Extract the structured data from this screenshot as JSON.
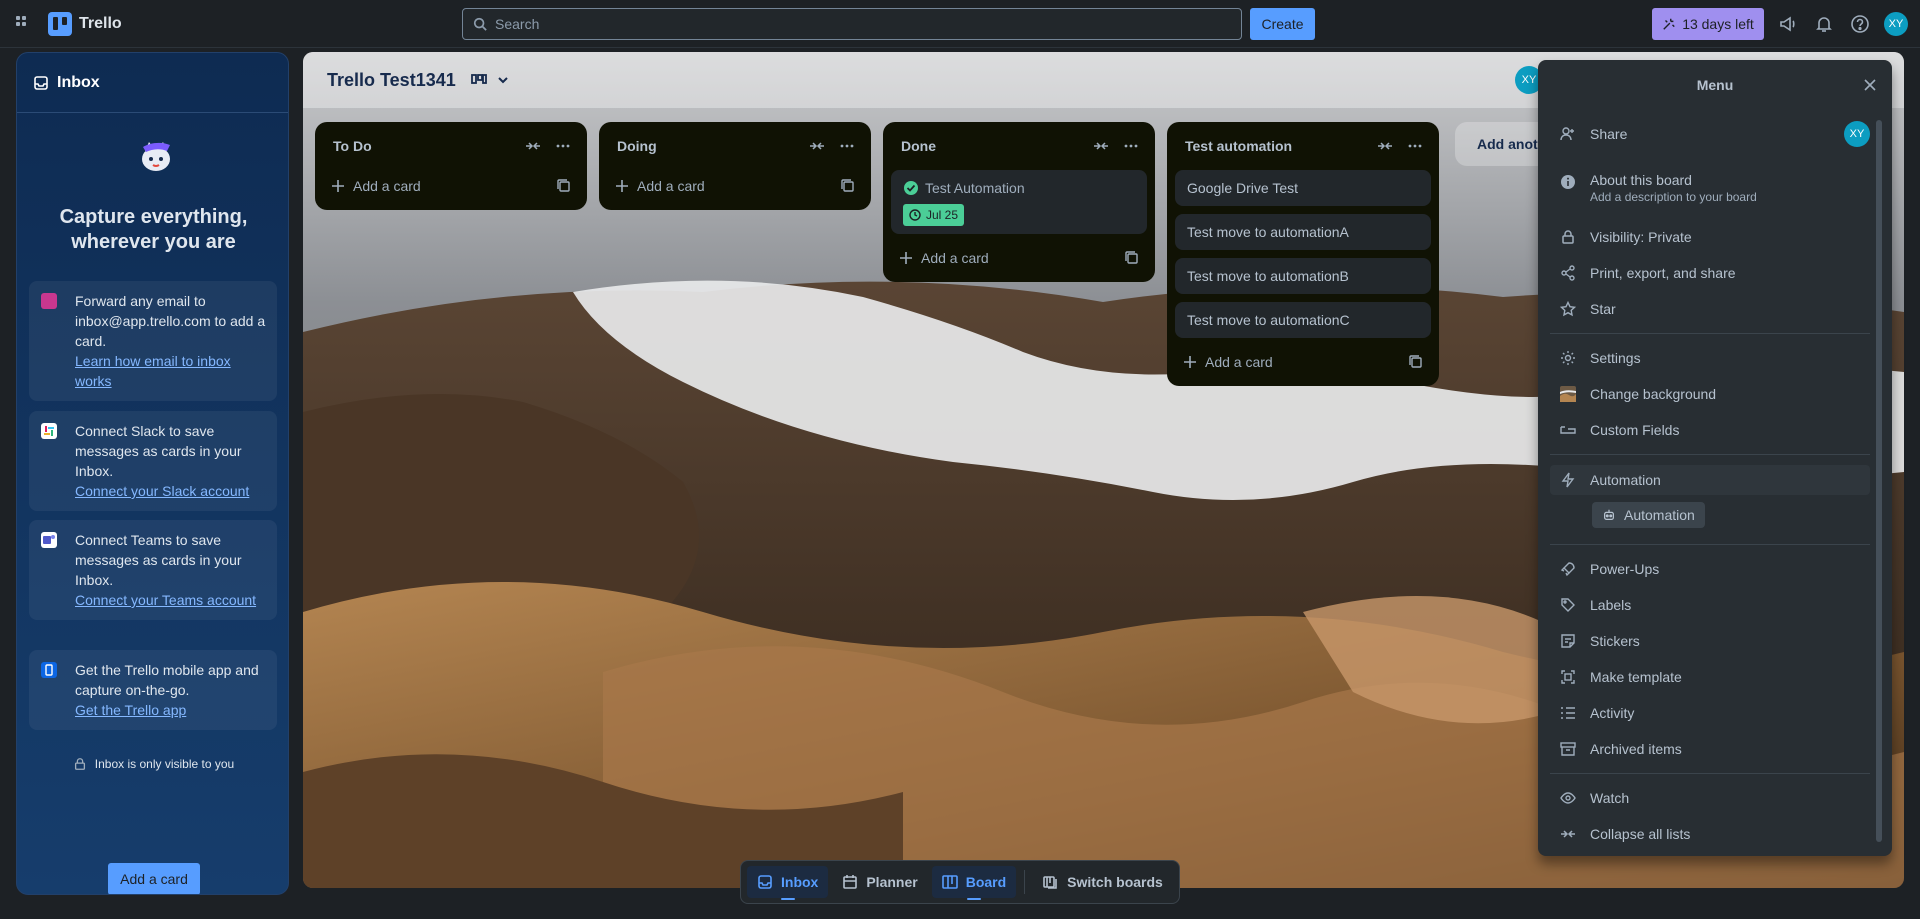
{
  "topbar": {
    "app_name": "Trello",
    "search_placeholder": "Search",
    "create_label": "Create",
    "trial_label": "13 days left",
    "user_initials": "XY"
  },
  "inbox": {
    "title": "Inbox",
    "headline": "Capture everything, wherever you are",
    "tips": [
      {
        "text": "Forward any email to inbox@app.trello.com to add a card.",
        "link": "Learn how email to inbox works"
      },
      {
        "text": "Connect Slack to save messages as cards in your Inbox.",
        "link": "Connect your Slack account"
      },
      {
        "text": "Connect Teams to save messages as cards in your Inbox.",
        "link": "Connect your Teams account"
      },
      {
        "text": "Get the Trello mobile app and capture on-the-go.",
        "link": "Get the Trello app"
      }
    ],
    "privacy_note": "Inbox is only visible to you",
    "add_card_label": "Add a card"
  },
  "board": {
    "title": "Trello Test1341",
    "member_initials": "XY",
    "add_another_label": "Add another list",
    "add_card_label": "Add a card",
    "lists": [
      {
        "title": "To Do",
        "cards": []
      },
      {
        "title": "Doing",
        "cards": []
      },
      {
        "title": "Done",
        "cards": [
          {
            "title": "Test Automation",
            "due": "Jul 25",
            "complete": true
          }
        ]
      },
      {
        "title": "Test automation",
        "cards": [
          {
            "title": "Google Drive Test"
          },
          {
            "title": "Test move to automationA"
          },
          {
            "title": "Test move to automationB"
          },
          {
            "title": "Test move to automationC"
          }
        ]
      }
    ]
  },
  "menu": {
    "title": "Menu",
    "share": "Share",
    "share_initials": "XY",
    "about_title": "About this board",
    "about_sub": "Add a description to your board",
    "visibility": "Visibility: Private",
    "print": "Print, export, and share",
    "star": "Star",
    "settings": "Settings",
    "change_background": "Change background",
    "custom_fields": "Custom Fields",
    "automation": "Automation",
    "automation_chip": "Automation",
    "power_ups": "Power-Ups",
    "labels": "Labels",
    "stickers": "Stickers",
    "make_template": "Make template",
    "activity": "Activity",
    "archived": "Archived items",
    "watch": "Watch",
    "collapse_all": "Collapse all lists"
  },
  "bottom_nav": {
    "inbox": "Inbox",
    "planner": "Planner",
    "board": "Board",
    "switch_boards": "Switch boards"
  },
  "colors": {
    "accent": "#579dff",
    "trial": "#9f8fef",
    "list_bg": "#101204",
    "menu_bg": "#282e33",
    "due_complete": "#4bce97"
  }
}
